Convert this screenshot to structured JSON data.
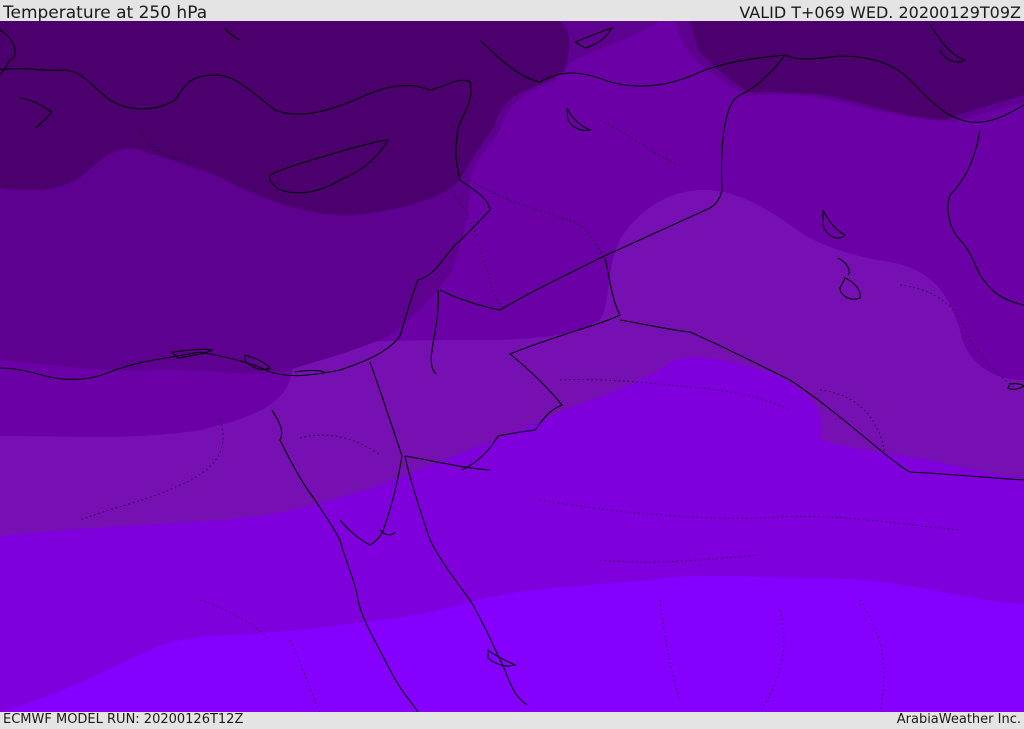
{
  "header": {
    "title": "Temperature at 250 hPa",
    "valid_time": "VALID T+069 WED. 20200129T09Z"
  },
  "footer": {
    "model_run": "ECMWF MODEL RUN: 20200126T12Z",
    "credit": "ArabiaWeather Inc."
  },
  "colors": {
    "band_darkest": "#4c006e",
    "band_dark": "#5e0090",
    "band_mid": "#6a00a6",
    "band_midlight": "#7710b2",
    "band_light": "#7f00dc",
    "band_lightest": "#8500ff",
    "outline": "#000000"
  }
}
